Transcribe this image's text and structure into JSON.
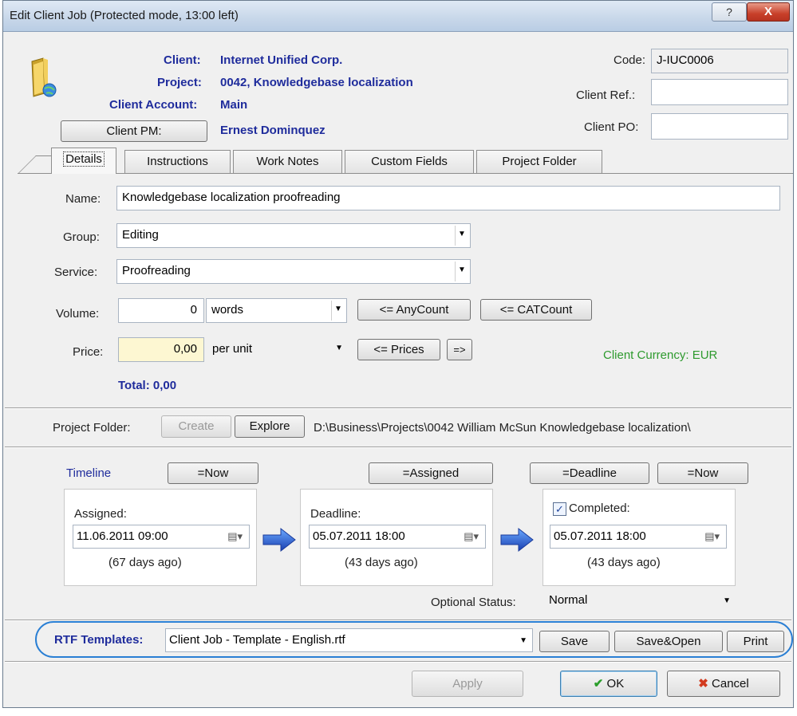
{
  "window": {
    "title": "Edit Client Job (Protected mode, 13:00 left)",
    "help": "?",
    "close": "X"
  },
  "header": {
    "client_label": "Client:",
    "client_value": "Internet Unified Corp.",
    "project_label": "Project:",
    "project_value": "0042, Knowledgebase localization",
    "account_label": "Client Account:",
    "account_value": "Main",
    "pm_button": "Client PM:",
    "pm_value": "Ernest Dominquez",
    "code_label": "Code:",
    "code_value": "J-IUC0006",
    "ref_label": "Client Ref.:",
    "ref_value": "",
    "po_label": "Client PO:",
    "po_value": ""
  },
  "tabs": [
    "Details",
    "Instructions",
    "Work Notes",
    "Custom Fields",
    "Project Folder"
  ],
  "details": {
    "name_label": "Name:",
    "name_value": "Knowledgebase localization proofreading",
    "group_label": "Group:",
    "group_value": "Editing",
    "service_label": "Service:",
    "service_value": "Proofreading",
    "volume_label": "Volume:",
    "volume_value": "0",
    "volume_unit": "words",
    "anycount_button": "<= AnyCount",
    "catcount_button": "<= CATCount",
    "price_label": "Price:",
    "price_value": "0,00",
    "price_unit": "per unit",
    "prices_button": "<= Prices",
    "arrow_button": "=>",
    "currency": "Client Currency: EUR",
    "total": "Total: 0,00"
  },
  "folder": {
    "label": "Project Folder:",
    "create_button": "Create",
    "explore_button": "Explore",
    "path": "D:\\Business\\Projects\\0042 William McSun Knowledgebase localization\\"
  },
  "timeline": {
    "title": "Timeline",
    "now_button": "=Now",
    "assigned_button": "=Assigned",
    "deadline_button": "=Deadline",
    "now_button2": "=Now",
    "assigned_label": "Assigned:",
    "assigned_value": "11.06.2011 09:00",
    "assigned_ago": "(67 days ago)",
    "deadline_label": "Deadline:",
    "deadline_value": "05.07.2011 18:00",
    "deadline_ago": "(43 days ago)",
    "completed_label": "Completed:",
    "completed_value": "05.07.2011 18:00",
    "completed_ago": "(43 days ago)",
    "optional_status_label": "Optional Status:",
    "optional_status_value": "Normal"
  },
  "templates": {
    "label": "RTF Templates:",
    "value": "Client Job - Template - English.rtf",
    "save_button": "Save",
    "saveopen_button": "Save&Open",
    "print_button": "Print"
  },
  "footer": {
    "apply_button": "Apply",
    "ok_button": "OK",
    "cancel_button": "Cancel"
  },
  "colors": {
    "label_blue": "#1f2c9c",
    "currency_green": "#2e9a2e",
    "highlight_oval": "#2a7fd4",
    "price_bg": "#fdf7d2"
  }
}
